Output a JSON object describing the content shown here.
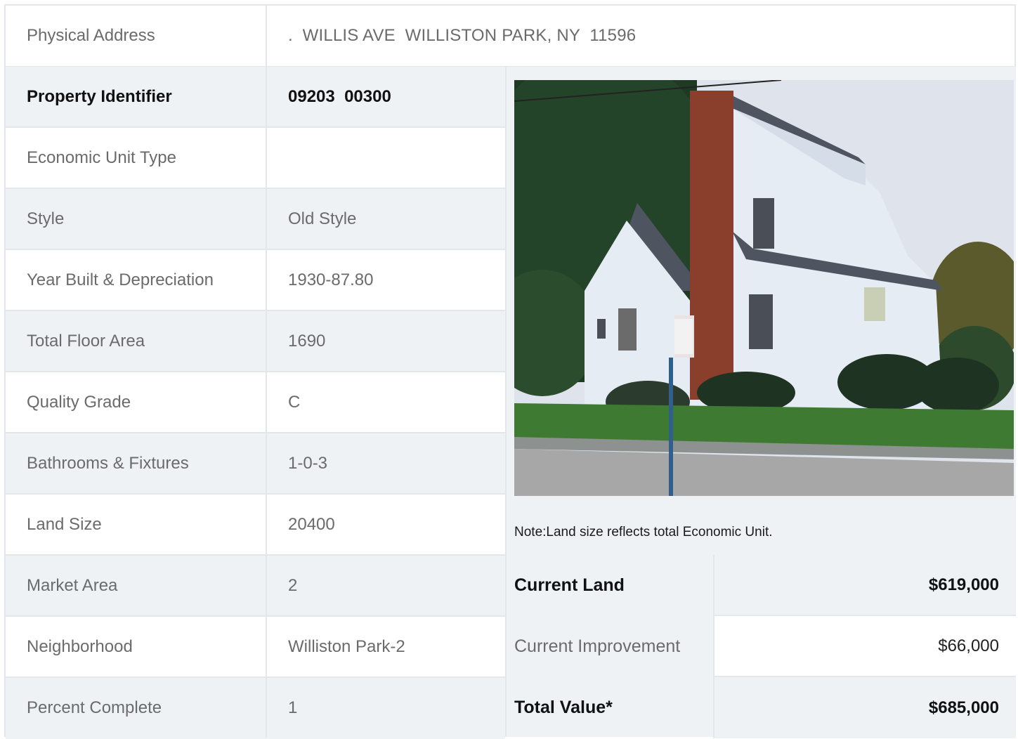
{
  "address": {
    "label": "Physical Address",
    "value": ".  WILLIS AVE  WILLISTON PARK, NY  11596"
  },
  "details": [
    {
      "label": "Property Identifier",
      "value": "09203  00300",
      "bold": true
    },
    {
      "label": "Economic Unit Type",
      "value": ""
    },
    {
      "label": "Style",
      "value": "Old Style"
    },
    {
      "label": "Year Built & Depreciation",
      "value": "1930-87.80"
    },
    {
      "label": "Total Floor Area",
      "value": "1690"
    },
    {
      "label": "Quality Grade",
      "value": "C"
    },
    {
      "label": "Bathrooms & Fixtures",
      "value": "1-0-3"
    },
    {
      "label": "Land Size",
      "value": "20400"
    },
    {
      "label": "Market Area",
      "value": "2"
    },
    {
      "label": "Neighborhood",
      "value": "Williston Park-2"
    },
    {
      "label": "Percent Complete",
      "value": "1"
    }
  ],
  "note": "Note:Land size reflects total Economic Unit.",
  "valuation": [
    {
      "label": "Current Land",
      "value": "$619,000",
      "bold": true
    },
    {
      "label": "Current Improvement",
      "value": "$66,000",
      "bold": false
    },
    {
      "label": "Total Value*",
      "value": "$685,000",
      "bold": true
    }
  ],
  "photo": {
    "icon": "house-photo",
    "colors": {
      "sky": "#dfe4ec",
      "trees": "#1f3a22",
      "house": "#e6ecf4",
      "roof": "#4f5560",
      "chimney": "#8a3f2c",
      "grass": "#3f7a33",
      "sidewalk": "#a7a7a7"
    }
  }
}
